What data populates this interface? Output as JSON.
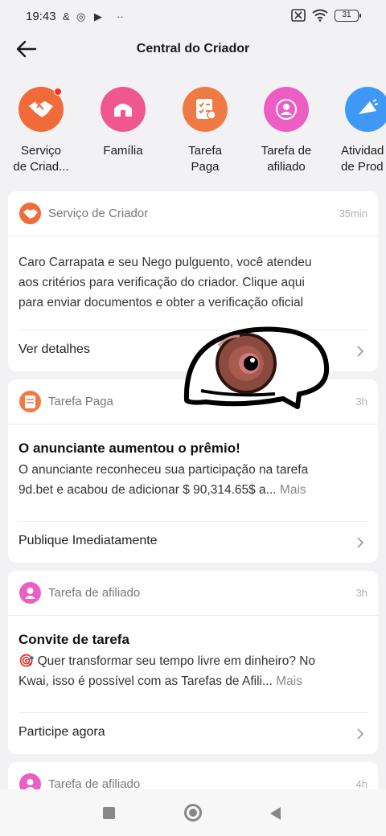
{
  "status_bar": {
    "time": "19:43",
    "notif_icons": [
      "&",
      "◎",
      "▶",
      "··"
    ],
    "battery": "31"
  },
  "header": {
    "title": "Central do Criador"
  },
  "categories": [
    {
      "label": "Serviço de Criad...",
      "line1": "Serviço",
      "line2": "de Criad...",
      "icon": "handshake-icon",
      "color": "#f06a3a",
      "badge": true
    },
    {
      "label": "Família",
      "line1": "Família",
      "line2": "",
      "icon": "house-icon",
      "color": "#f0588d",
      "badge": false
    },
    {
      "label": "Tarefa Paga",
      "line1": "Tarefa",
      "line2": "Paga",
      "icon": "checklist-icon",
      "color": "#f07a44",
      "badge": false
    },
    {
      "label": "Tarefa de afiliado",
      "line1": "Tarefa de",
      "line2": "afiliado",
      "icon": "affiliate-icon",
      "color": "#ec5ec3",
      "badge": false
    },
    {
      "label": "Atividade de Produto",
      "line1": "Atividad",
      "line2": "de Prod",
      "icon": "megaphone-icon",
      "color": "#3f98f5",
      "badge": false
    }
  ],
  "cards": [
    {
      "source": "Serviço de Criador",
      "time": "35min",
      "title": "",
      "body_lines": [
        "Caro Carrapata e seu Nego pulguento, você atendeu",
        "aos critérios para verificação do criador. Clique aqui",
        "para enviar documentos e obter a verificação oficial"
      ],
      "more": "",
      "action": "Ver detalhes"
    },
    {
      "source": "Tarefa Paga",
      "time": "3h",
      "title": "O anunciante aumentou o prêmio!",
      "body_lines": [
        "O anunciante reconheceu sua participação na tarefa",
        "9d.bet e acabou de adicionar $ 90,314.65$ a..."
      ],
      "more": "Mais",
      "action": "Publique Imediatamente"
    },
    {
      "source": "Tarefa de afiliado",
      "time": "3h",
      "title": "Convite de tarefa",
      "body_lines": [
        "🎯 Quer transformar seu tempo livre em dinheiro? No",
        "Kwai, isso é possível com as Tarefas de Afili..."
      ],
      "more": "Mais",
      "action": "Participe agora"
    },
    {
      "source": "Tarefa de afiliado",
      "time": "4h",
      "title": "",
      "body_lines": [],
      "more": "",
      "action": ""
    }
  ],
  "colors": {
    "bg": "#f2f2f4",
    "card": "#ffffff",
    "muted": "#777777"
  }
}
